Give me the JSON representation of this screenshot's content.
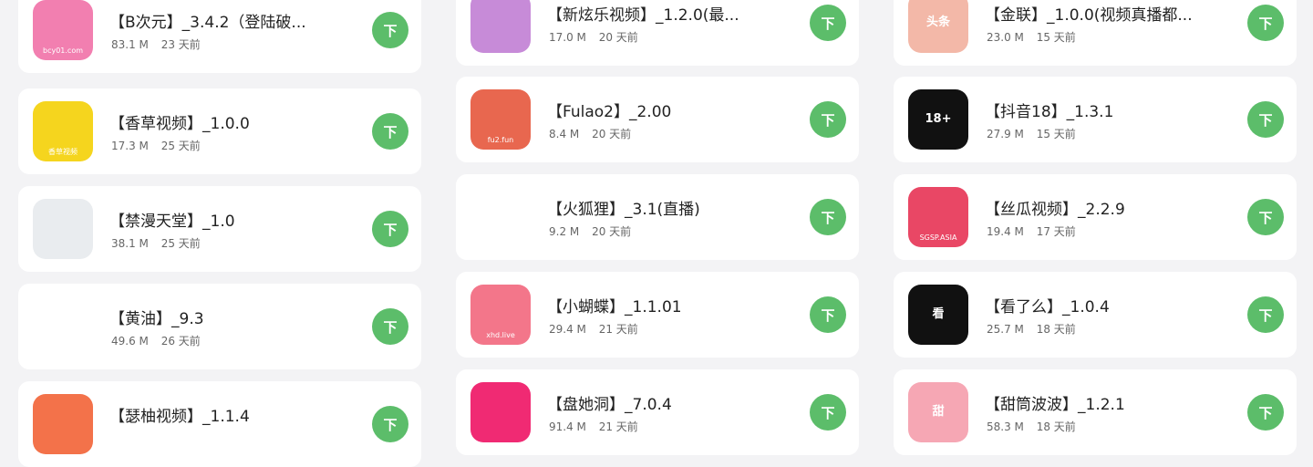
{
  "columns": [
    {
      "cards": [
        {
          "title": "【B次元】_3.4.2（登陆破...",
          "size": "83.1 M",
          "days": "23 天前",
          "button": "下",
          "icon_name": "bciyuan-app-icon",
          "icon_text": "",
          "icon_sub": "bcy01.com",
          "icon_bg": "#f27fb0"
        },
        {
          "title": "【香草视频】_1.0.0",
          "size": "17.3 M",
          "days": "25 天前",
          "button": "下",
          "icon_name": "xiangcao-app-icon",
          "icon_text": "",
          "icon_sub": "香草视频",
          "icon_bg": "#f5d51e"
        },
        {
          "title": "【禁漫天堂】_1.0",
          "size": "38.1 M",
          "days": "25 天前",
          "button": "下",
          "icon_name": "jinman-app-icon",
          "icon_text": "",
          "icon_sub": "",
          "icon_bg": "#e9ecef"
        },
        {
          "title": "【黄油】_9.3",
          "size": "49.6 M",
          "days": "26 天前",
          "button": "下",
          "icon_name": "huangyou-app-icon",
          "icon_text": "",
          "icon_sub": "",
          "icon_bg": "#ffffff"
        },
        {
          "title": "【瑟柚视频】_1.1.4",
          "size": "",
          "days": "",
          "button": "下",
          "icon_name": "seyou-app-icon",
          "icon_text": "",
          "icon_sub": "",
          "icon_bg": "#f3724a"
        }
      ]
    },
    {
      "cards": [
        {
          "title": "【新炫乐视频】_1.2.0(最...",
          "size": "17.0 M",
          "days": "20 天前",
          "button": "下",
          "icon_name": "xinxuanle-app-icon",
          "icon_text": "",
          "icon_sub": "",
          "icon_bg": "#c78bd8"
        },
        {
          "title": "【Fulao2】_2.00",
          "size": "8.4 M",
          "days": "20 天前",
          "button": "下",
          "icon_name": "fulao2-app-icon",
          "icon_text": "",
          "icon_sub": "fu2.fun",
          "icon_bg": "#e8674f"
        },
        {
          "title": "【火狐狸】_3.1(直播)",
          "size": "9.2 M",
          "days": "20 天前",
          "button": "下",
          "icon_name": "huohuli-app-icon",
          "icon_text": "",
          "icon_sub": "",
          "icon_bg": "#ffffff"
        },
        {
          "title": "【小蝴蝶】_1.1.01",
          "size": "29.4 M",
          "days": "21 天前",
          "button": "下",
          "icon_name": "xiaohudie-app-icon",
          "icon_text": "",
          "icon_sub": "xhd.live",
          "icon_bg": "#f3768a"
        },
        {
          "title": "【盘她洞】_7.0.4",
          "size": "91.4 M",
          "days": "21 天前",
          "button": "下",
          "icon_name": "pantadong-app-icon",
          "icon_text": "",
          "icon_sub": "",
          "icon_bg": "#f02a73"
        }
      ]
    },
    {
      "cards": [
        {
          "title": "【金联】_1.0.0(视频真播都...",
          "size": "23.0 M",
          "days": "15 天前",
          "button": "下",
          "icon_name": "jinlian-app-icon",
          "icon_text": "头条",
          "icon_sub": "",
          "icon_bg": "#f3b8a8"
        },
        {
          "title": "【抖音18】_1.3.1",
          "size": "27.9 M",
          "days": "15 天前",
          "button": "下",
          "icon_name": "douyin18-app-icon",
          "icon_text": "18+",
          "icon_sub": "",
          "icon_bg": "#111111"
        },
        {
          "title": "【丝瓜视频】_2.2.9",
          "size": "19.4 M",
          "days": "17 天前",
          "button": "下",
          "icon_name": "sigua-app-icon",
          "icon_text": "",
          "icon_sub": "SGSP.ASIA",
          "icon_bg": "#e94765"
        },
        {
          "title": "【看了么】_1.0.4",
          "size": "25.7 M",
          "days": "18 天前",
          "button": "下",
          "icon_name": "kanleme-app-icon",
          "icon_text": "看",
          "icon_sub": "",
          "icon_bg": "#111111"
        },
        {
          "title": "【甜筒波波】_1.2.1",
          "size": "58.3 M",
          "days": "18 天前",
          "button": "下",
          "icon_name": "tiantong-app-icon",
          "icon_text": "甜",
          "icon_sub": "",
          "icon_bg": "#f6a7b4"
        }
      ]
    }
  ]
}
